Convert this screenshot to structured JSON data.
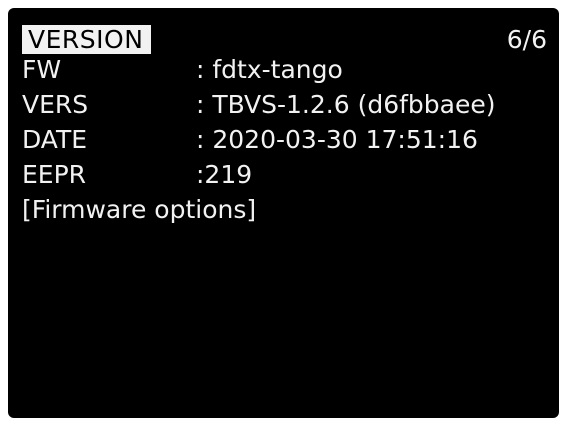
{
  "header": {
    "title": "VERSION",
    "page_indicator": "6/6"
  },
  "info": {
    "fw": {
      "label": "FW",
      "value": ": fdtx-tango"
    },
    "vers": {
      "label": "VERS",
      "value": ": TBVS-1.2.6 (d6fbbaee)"
    },
    "date": {
      "label": "DATE",
      "value": ": 2020-03-30 17:51:16"
    },
    "eepr": {
      "label": "EEPR",
      "value": ":219"
    }
  },
  "firmware_options_label": "[Firmware options]",
  "colors": {
    "background": "#000000",
    "text": "#f2f2f2",
    "title_highlight": "#f2f2f2"
  }
}
